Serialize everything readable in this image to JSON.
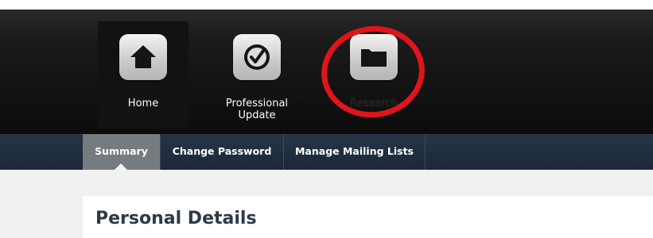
{
  "top_nav": {
    "items": [
      {
        "label": "Home",
        "icon": "home-icon"
      },
      {
        "label": "Professional\nUpdate",
        "icon": "checkmark-icon"
      },
      {
        "label": "Research",
        "icon": "folder-icon"
      }
    ],
    "highlight_color": "#e0141b"
  },
  "sub_nav": {
    "tabs": [
      {
        "label": "Summary",
        "active": true
      },
      {
        "label": "Change Password",
        "active": false
      },
      {
        "label": "Manage Mailing Lists",
        "active": false
      }
    ]
  },
  "content": {
    "section_title": "Personal Details"
  }
}
